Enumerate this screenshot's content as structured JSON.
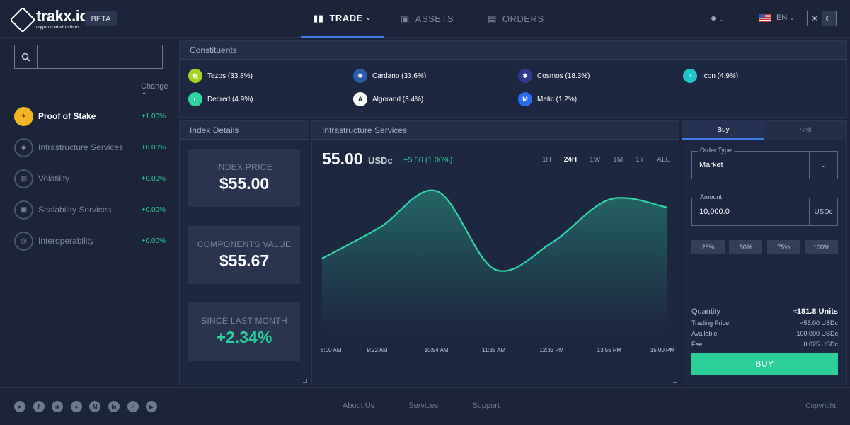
{
  "brand": {
    "name": "trakx.io",
    "tagline": "crypto traded indices",
    "beta": "BETA"
  },
  "nav": [
    {
      "label": "TRADE",
      "icon": "bar-chart-icon",
      "active": true
    },
    {
      "label": "ASSETS",
      "icon": "wallet-icon",
      "active": false
    },
    {
      "label": "ORDERS",
      "icon": "list-icon",
      "active": false
    }
  ],
  "language": "EN",
  "sidebar": {
    "search_placeholder": "",
    "change_header": "Change",
    "items": [
      {
        "name": "Proof of Stake",
        "change": "+1.00%",
        "active": true
      },
      {
        "name": "Infrastructure Services",
        "change": "+0.00%",
        "active": false
      },
      {
        "name": "Volatility",
        "change": "+0.00%",
        "active": false
      },
      {
        "name": "Scalability Services",
        "change": "+0.00%",
        "active": false
      },
      {
        "name": "Interoperability",
        "change": "+0.00%",
        "active": false
      }
    ]
  },
  "constituents": {
    "title": "Constituents",
    "items": [
      {
        "label": "Tezos (33.8%)",
        "color": "#a6d424"
      },
      {
        "label": "Cardano (33.6%)",
        "color": "#2a5ea8"
      },
      {
        "label": "Cosmos (18.3%)",
        "color": "#2e3a8c"
      },
      {
        "label": "Icon (4.9%)",
        "color": "#1fc5c9"
      },
      {
        "label": "Decred (4.9%)",
        "color": "#2ed6a1"
      },
      {
        "label": "Algorand (3.4%)",
        "color": "#ffffff"
      },
      {
        "label": "Matic (1.2%)",
        "color": "#2b6def"
      }
    ]
  },
  "index_details": {
    "title": "Index Details",
    "index_price_label": "INDEX PRICE",
    "index_price": "$55.00",
    "components_label": "COMPONENTS VALUE",
    "components_value": "$55.67",
    "since_label": "SINCE LAST MONTH",
    "since_value": "+2.34%"
  },
  "chart_panel": {
    "title": "Infrastructure Services",
    "price": "55.00",
    "unit": "USDc",
    "change": "+5.50 (1.00%)",
    "ranges": [
      "1H",
      "24H",
      "1W",
      "1M",
      "1Y",
      "ALL"
    ],
    "active_range": "24H"
  },
  "chart_data": {
    "type": "area",
    "x": [
      "6:00 AM",
      "9:22 AM",
      "10:54 AM",
      "11:35 AM",
      "12:33 PM",
      "13:55 PM",
      "15:00 PM"
    ],
    "values": [
      4.0,
      6.3,
      9.0,
      3.2,
      5.2,
      8.4,
      7.8
    ],
    "ylim": [
      0,
      10
    ],
    "line_color": "#2fd6a6",
    "grid": false
  },
  "trade": {
    "tabs": [
      "Buy",
      "Sell"
    ],
    "order_type_label": "Order Type",
    "order_type_value": "Market",
    "amount_label": "Amount",
    "amount_value": "10,000.0",
    "amount_unit": "USDc",
    "percents": [
      "25%",
      "50%",
      "75%",
      "100%"
    ],
    "quantity_label": "Quantity",
    "quantity_value": "≈181.8 Units",
    "trading_price_label": "Trading Price",
    "trading_price_value": "≈55.00 USDc",
    "available_label": "Available",
    "available_value": "100,000 USDc",
    "fee_label": "Fee",
    "fee_value": "0.025 USDc",
    "buy_label": "BUY"
  },
  "footer": {
    "socials": [
      "telegram-icon",
      "facebook-icon",
      "reddit-icon",
      "github-icon",
      "medium-icon",
      "linkedin-icon",
      "twitter-icon",
      "youtube-icon"
    ],
    "links": [
      "About Us",
      "Services",
      "Support"
    ],
    "copyright": "Copyright"
  }
}
